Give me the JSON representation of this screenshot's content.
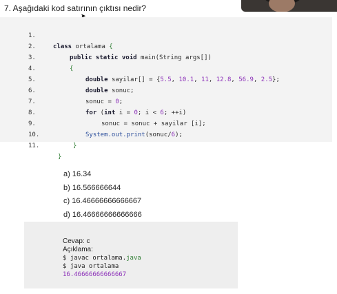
{
  "question": "7. Aşağıdaki kod satırının çıktısı nedir?",
  "code": {
    "line_numbers": [
      "1.",
      "2.",
      "3.",
      "4.",
      "5.",
      "6.",
      "7.",
      "8.",
      "9.",
      "10.",
      "11."
    ],
    "l1": {
      "kw": "class",
      "name": "ortalama",
      "brace": "{"
    },
    "l2": {
      "kw": "public static void",
      "rest": "main(String args[])"
    },
    "l3": {
      "brace": "{"
    },
    "l4": {
      "kw": "double",
      "a": "sayilar[] = {",
      "n1": "5.5",
      "n2": "10.1",
      "n3": "11",
      "n4": "12.8",
      "n5": "56.9",
      "n6": "2.5",
      "end": "};"
    },
    "l5": {
      "kw": "double",
      "rest": "sonuc;"
    },
    "l6": {
      "a": "sonuc = ",
      "n": "0",
      "end": ";"
    },
    "l7": {
      "kw": "for",
      "a": " (",
      "kw2": "int",
      "b": " i = ",
      "n1": "0",
      "c": "; i < ",
      "n2": "6",
      "d": "; ++i)"
    },
    "l8": {
      "a": "sonuc = sonuc + sayilar [i];"
    },
    "l9": {
      "cls": "System.out.print",
      "a": "(sonuc/",
      "n": "6",
      "end": ");"
    },
    "l10": {
      "brace": "}"
    },
    "l11": {
      "brace": "}"
    }
  },
  "answers": [
    "a) 16.34",
    "b) 16.566666644",
    "c) 16.46666666666667",
    "d) 16.46666666666666"
  ],
  "explanation": {
    "answer_label": "Cevap: c",
    "explanation_label": "Açıklama:",
    "cmd1_prefix": "$ javac ortalama.",
    "cmd1_ext": "java",
    "cmd2": "$ java ortalama",
    "output": "16.46666666666667"
  },
  "colors": {
    "number": "#8b2fb8",
    "keyword": "#1a1a2e",
    "class": "#2a4d9b",
    "brace": "#2e7d32"
  }
}
